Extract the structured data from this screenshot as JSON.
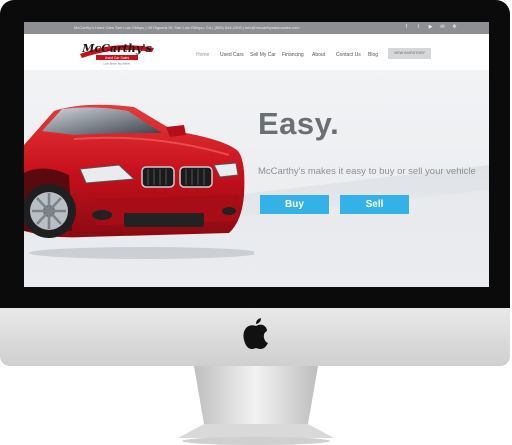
{
  "topbar": {
    "info": "McCarthy's Used Cars San Luis Obispo | 40 Higuera St, San Luis Obispo, CA | (805) 544-1900 | info@mccarthysautosales.com",
    "social_icons": [
      "facebook-icon",
      "twitter-icon",
      "youtube-icon",
      "email-icon",
      "yelp-icon"
    ]
  },
  "logo": {
    "wordmark": "McCarthy's",
    "tagline": "Used Car Sales",
    "subtag": "Look Better. Buy Better."
  },
  "nav": {
    "items": [
      "Home",
      "Used Cars",
      "Sell My Car",
      "Financing",
      "About",
      "Contact Us",
      "Blog"
    ],
    "active": "Home",
    "inventory_button": "VIEW INVENTORY"
  },
  "hero": {
    "headline": "Easy.",
    "subline": "McCarthy's makes it easy to buy or sell your vehicle",
    "buy_label": "Buy",
    "sell_label": "Sell"
  },
  "colors": {
    "accent": "#34b2e8",
    "topbar": "#8d8f92",
    "car": "#c8101c"
  }
}
